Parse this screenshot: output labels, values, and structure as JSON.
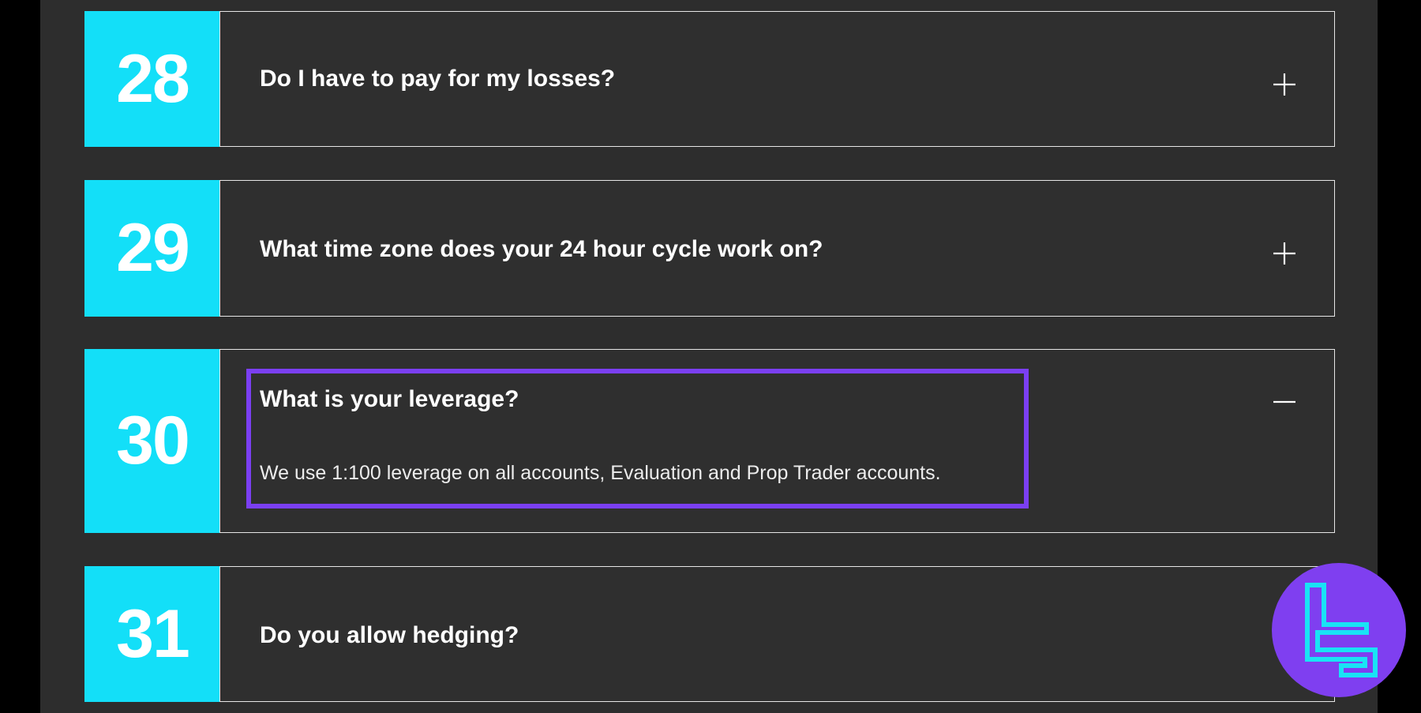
{
  "faq": [
    {
      "number": "28",
      "question": "Do I have to pay for my losses?",
      "state": "collapsed",
      "toggle_icon": "plus-icon"
    },
    {
      "number": "29",
      "question": "What time zone does your 24 hour cycle work on?",
      "state": "collapsed",
      "toggle_icon": "plus-icon"
    },
    {
      "number": "30",
      "question": "What is your leverage?",
      "state": "expanded",
      "toggle_icon": "minus-icon",
      "answer": "We use 1:100 leverage on all accounts, Evaluation and Prop Trader accounts."
    },
    {
      "number": "31",
      "question": "Do you allow hedging?",
      "state": "collapsed",
      "toggle_icon": "plus-icon"
    }
  ],
  "colors": {
    "number_badge": "#13dff8",
    "panel_bg": "#2d2d2d",
    "highlight": "#7b3ff2",
    "logo_bg": "#7f3ff0",
    "logo_fg": "#19e3f5"
  },
  "logo": {
    "icon": "tc-brand-logo"
  }
}
